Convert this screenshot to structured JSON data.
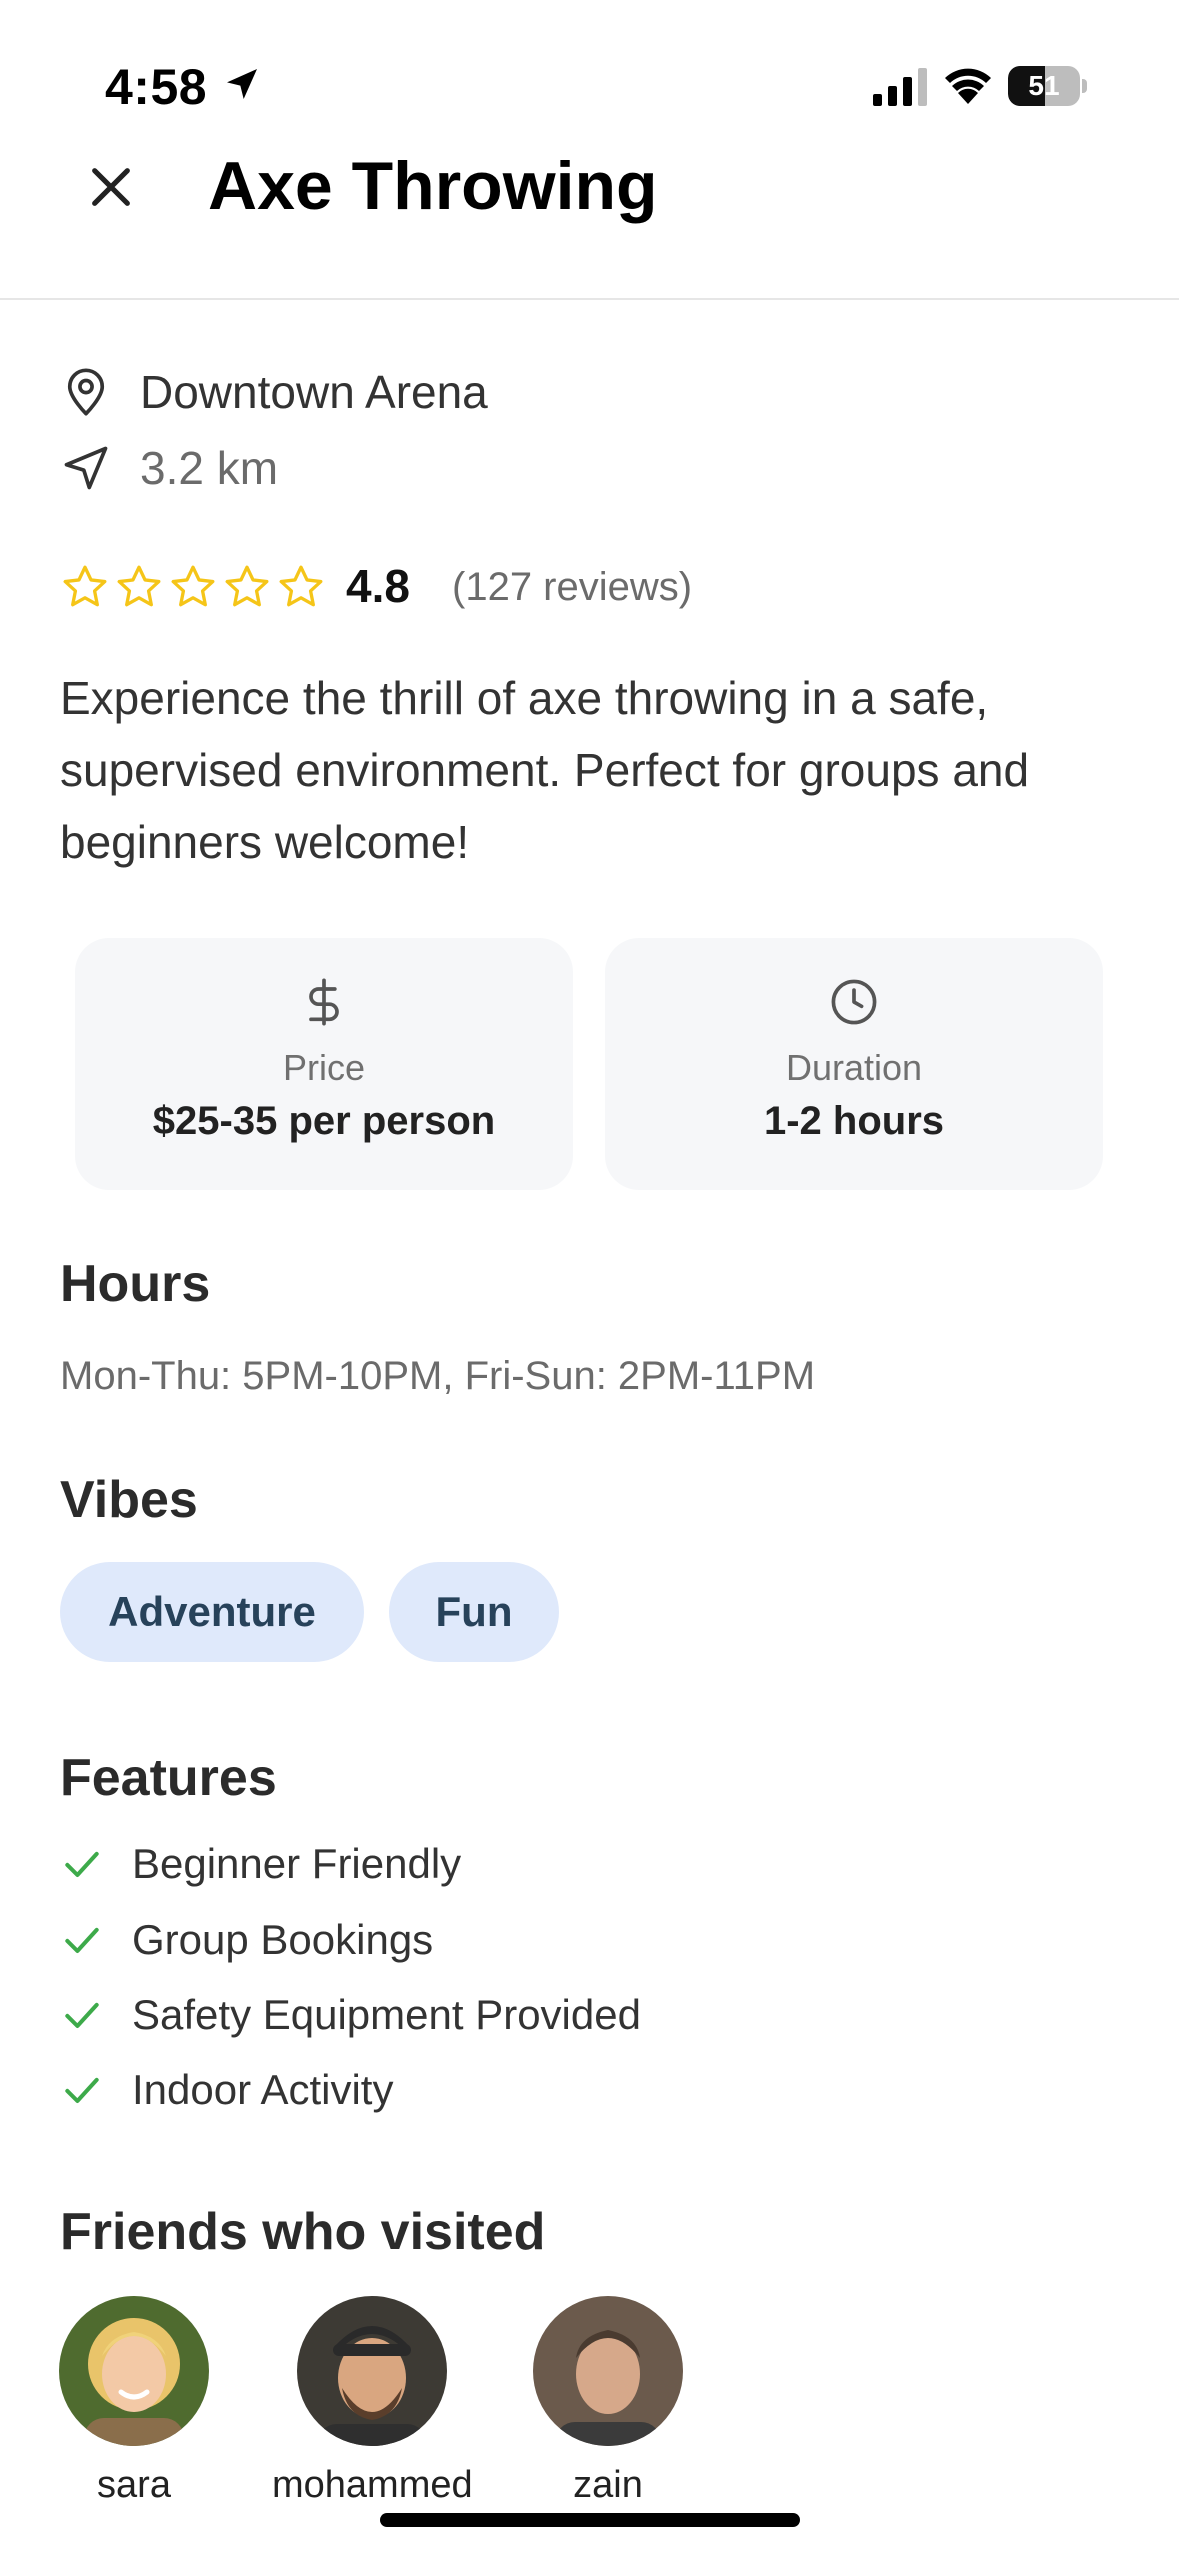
{
  "status_bar": {
    "time": "4:58",
    "battery": "51",
    "battery_level_percent": 51
  },
  "header": {
    "title": "Axe Throwing",
    "close_icon": "close-icon"
  },
  "location": {
    "venue": "Downtown Arena",
    "distance": "3.2 km"
  },
  "rating": {
    "score": "4.8",
    "reviews": "(127 reviews)",
    "stars_total": 5,
    "star_color": "#f5c518"
  },
  "description": "Experience the thrill of axe throwing in a safe, supervised environment. Perfect for groups and beginners welcome!",
  "info_cards": {
    "price": {
      "icon": "dollar-icon",
      "label": "Price",
      "value": "$25-35 per person"
    },
    "duration": {
      "icon": "clock-icon",
      "label": "Duration",
      "value": "1-2 hours"
    }
  },
  "hours": {
    "title": "Hours",
    "text": "Mon-Thu: 5PM-10PM, Fri-Sun: 2PM-11PM"
  },
  "vibes": {
    "title": "Vibes",
    "items": [
      "Adventure",
      "Fun"
    ]
  },
  "features": {
    "title": "Features",
    "items": [
      "Beginner Friendly",
      "Group Bookings",
      "Safety Equipment Provided",
      "Indoor Activity"
    ],
    "check_color": "#3daa4a"
  },
  "friends": {
    "title": "Friends who visited",
    "items": [
      "sara",
      "mohammed",
      "zain"
    ]
  },
  "colors": {
    "chip_bg": "#dfe9fb",
    "card_bg": "#f6f7f9"
  }
}
